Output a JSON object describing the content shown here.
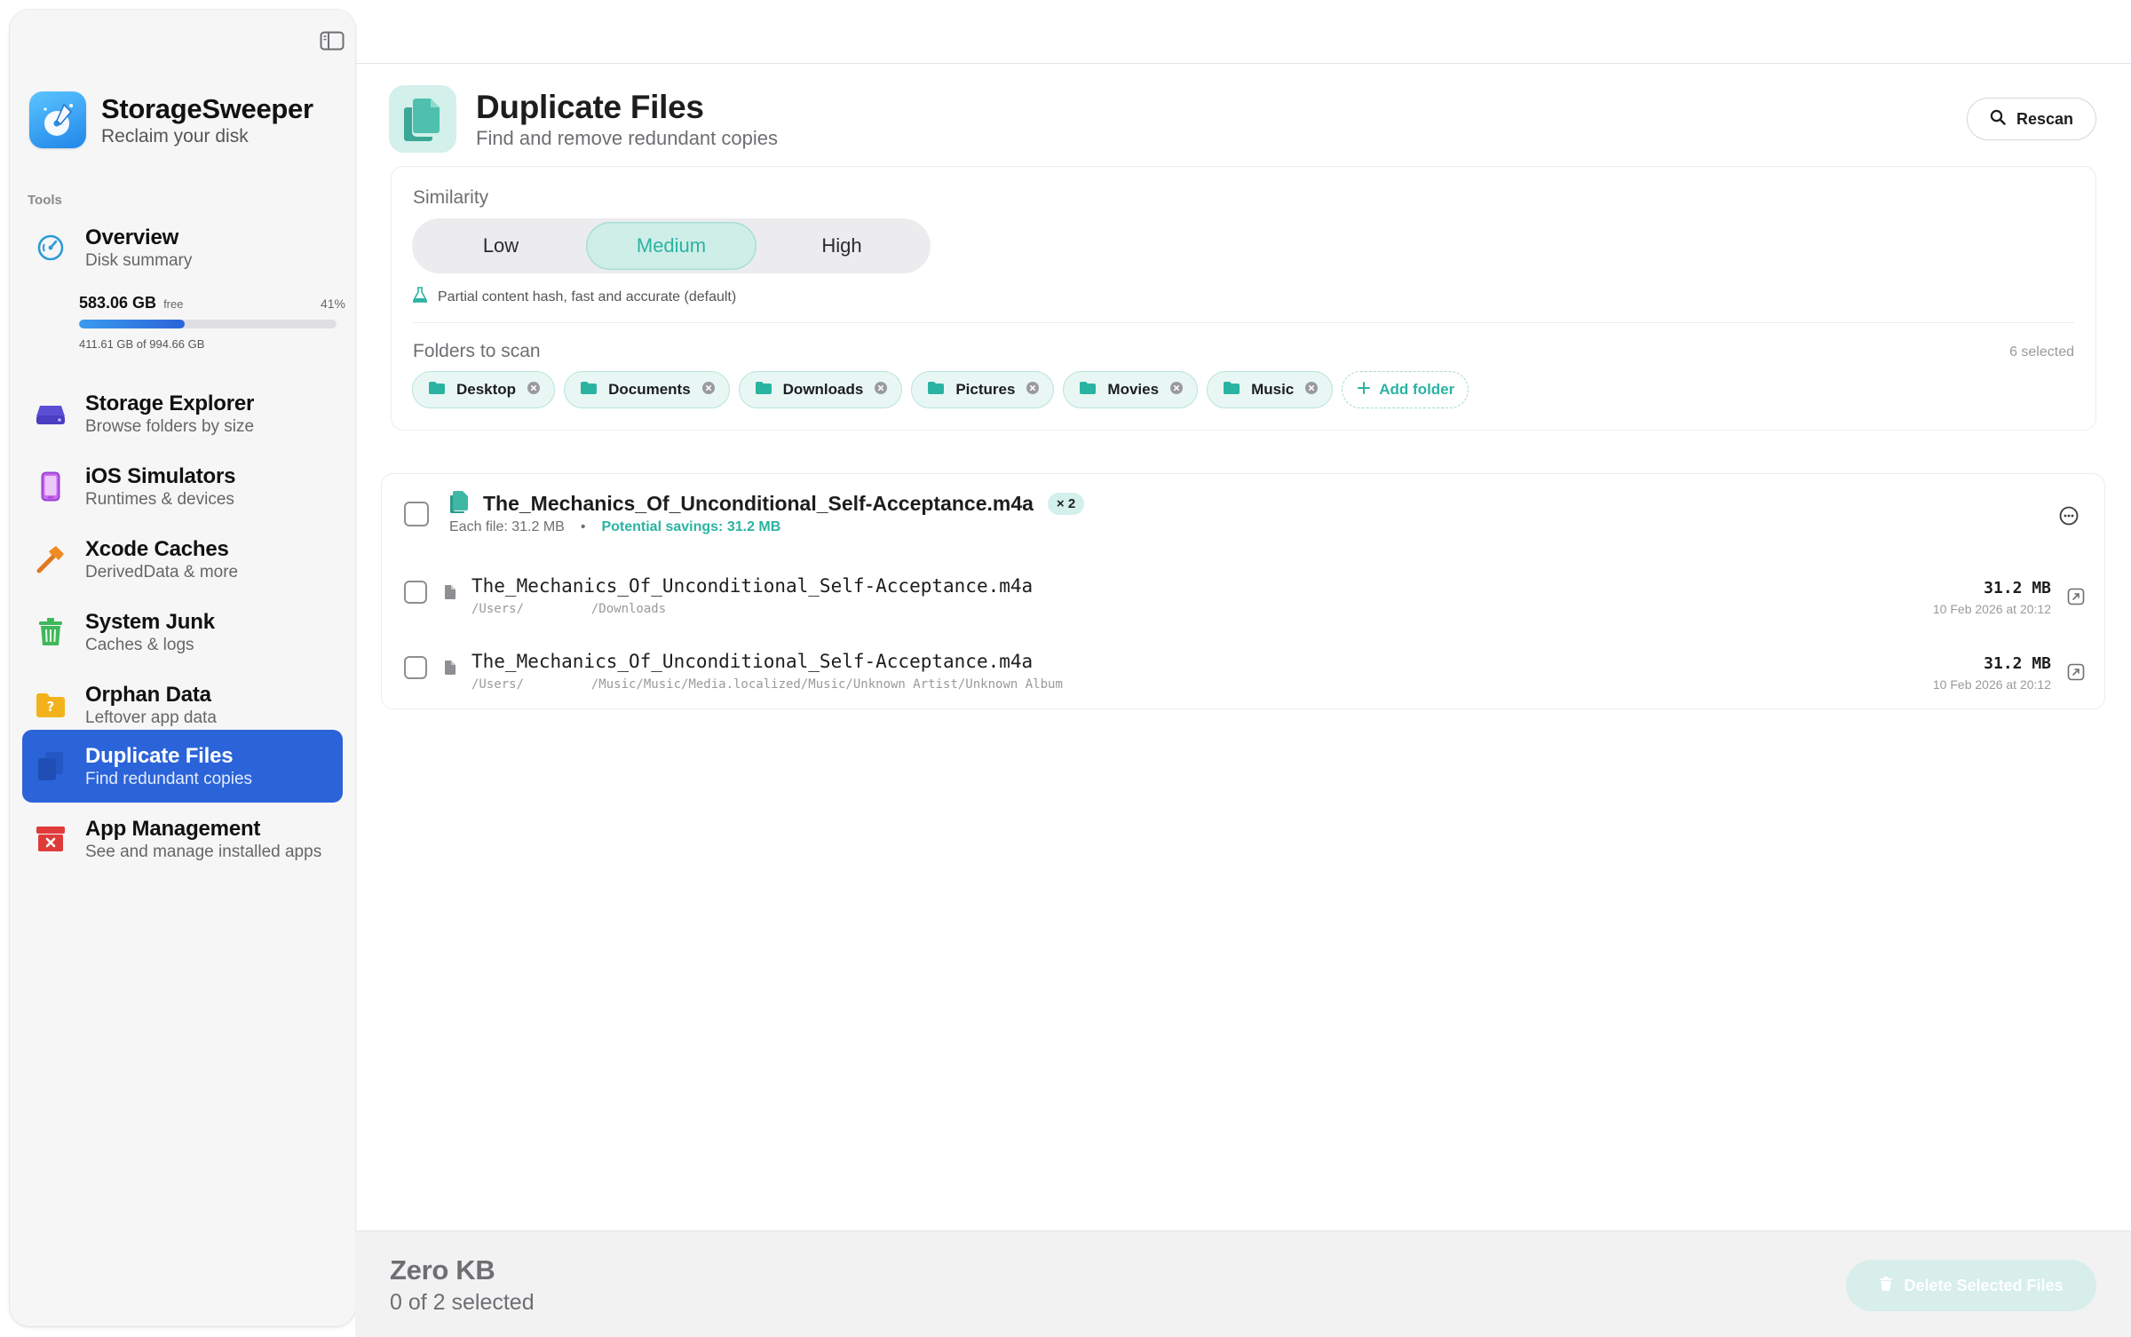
{
  "app": {
    "name": "StorageSweeper",
    "tagline": "Reclaim your disk"
  },
  "sidebar": {
    "section_label": "Tools",
    "items": [
      {
        "title": "Overview",
        "subtitle": "Disk summary",
        "icon": "gauge-icon"
      },
      {
        "title": "Storage Explorer",
        "subtitle": "Browse folders by size",
        "icon": "drive-icon"
      },
      {
        "title": "iOS Simulators",
        "subtitle": "Runtimes & devices",
        "icon": "iphone-icon"
      },
      {
        "title": "Xcode Caches",
        "subtitle": "DerivedData & more",
        "icon": "hammer-icon"
      },
      {
        "title": "System Junk",
        "subtitle": "Caches & logs",
        "icon": "trash-icon"
      },
      {
        "title": "Orphan Data",
        "subtitle": "Leftover app data",
        "icon": "question-folder-icon"
      },
      {
        "title": "Duplicate Files",
        "subtitle": "Find redundant copies",
        "icon": "duplicate-icon",
        "active": true
      },
      {
        "title": "App Management",
        "subtitle": "See and manage installed apps",
        "icon": "archive-box-icon"
      }
    ],
    "disk": {
      "free": "583.06 GB",
      "free_label": "free",
      "percent": "41%",
      "used_fraction": 0.41,
      "total": "411.61 GB of 994.66 GB"
    }
  },
  "header": {
    "title": "Duplicate Files",
    "subtitle": "Find and remove redundant copies",
    "rescan_label": "Rescan"
  },
  "options": {
    "similarity_label": "Similarity",
    "levels": [
      "Low",
      "Medium",
      "High"
    ],
    "selected_level": "Medium",
    "hint": "Partial content hash, fast and accurate (default)",
    "folders_label": "Folders to scan",
    "selected_count": "6 selected",
    "folders": [
      "Desktop",
      "Documents",
      "Downloads",
      "Pictures",
      "Movies",
      "Music"
    ],
    "add_folder_label": "Add folder"
  },
  "group": {
    "title": "The_Mechanics_Of_Unconditional_Self-Acceptance.m4a",
    "count": "× 2",
    "each_file": "Each file: 31.2 MB",
    "separator": "•",
    "savings": "Potential savings: 31.2 MB",
    "files": [
      {
        "name": "The_Mechanics_Of_Unconditional_Self-Acceptance.m4a",
        "path": "/Users/         /Downloads",
        "size": "31.2 MB",
        "date": "10 Feb 2026 at 20:12"
      },
      {
        "name": "The_Mechanics_Of_Unconditional_Self-Acceptance.m4a",
        "path": "/Users/         /Music/Music/Media.localized/Music/Unknown Artist/Unknown Album",
        "size": "31.2 MB",
        "date": "10 Feb 2026 at 20:12"
      }
    ]
  },
  "footer": {
    "selected_size": "Zero KB",
    "selected_count": "0 of 2 selected",
    "delete_label": "Delete Selected Files"
  },
  "colors": {
    "accent": "#2bb3a2",
    "active_nav": "#2b63d9",
    "tint_bg": "#d3f0eb"
  }
}
